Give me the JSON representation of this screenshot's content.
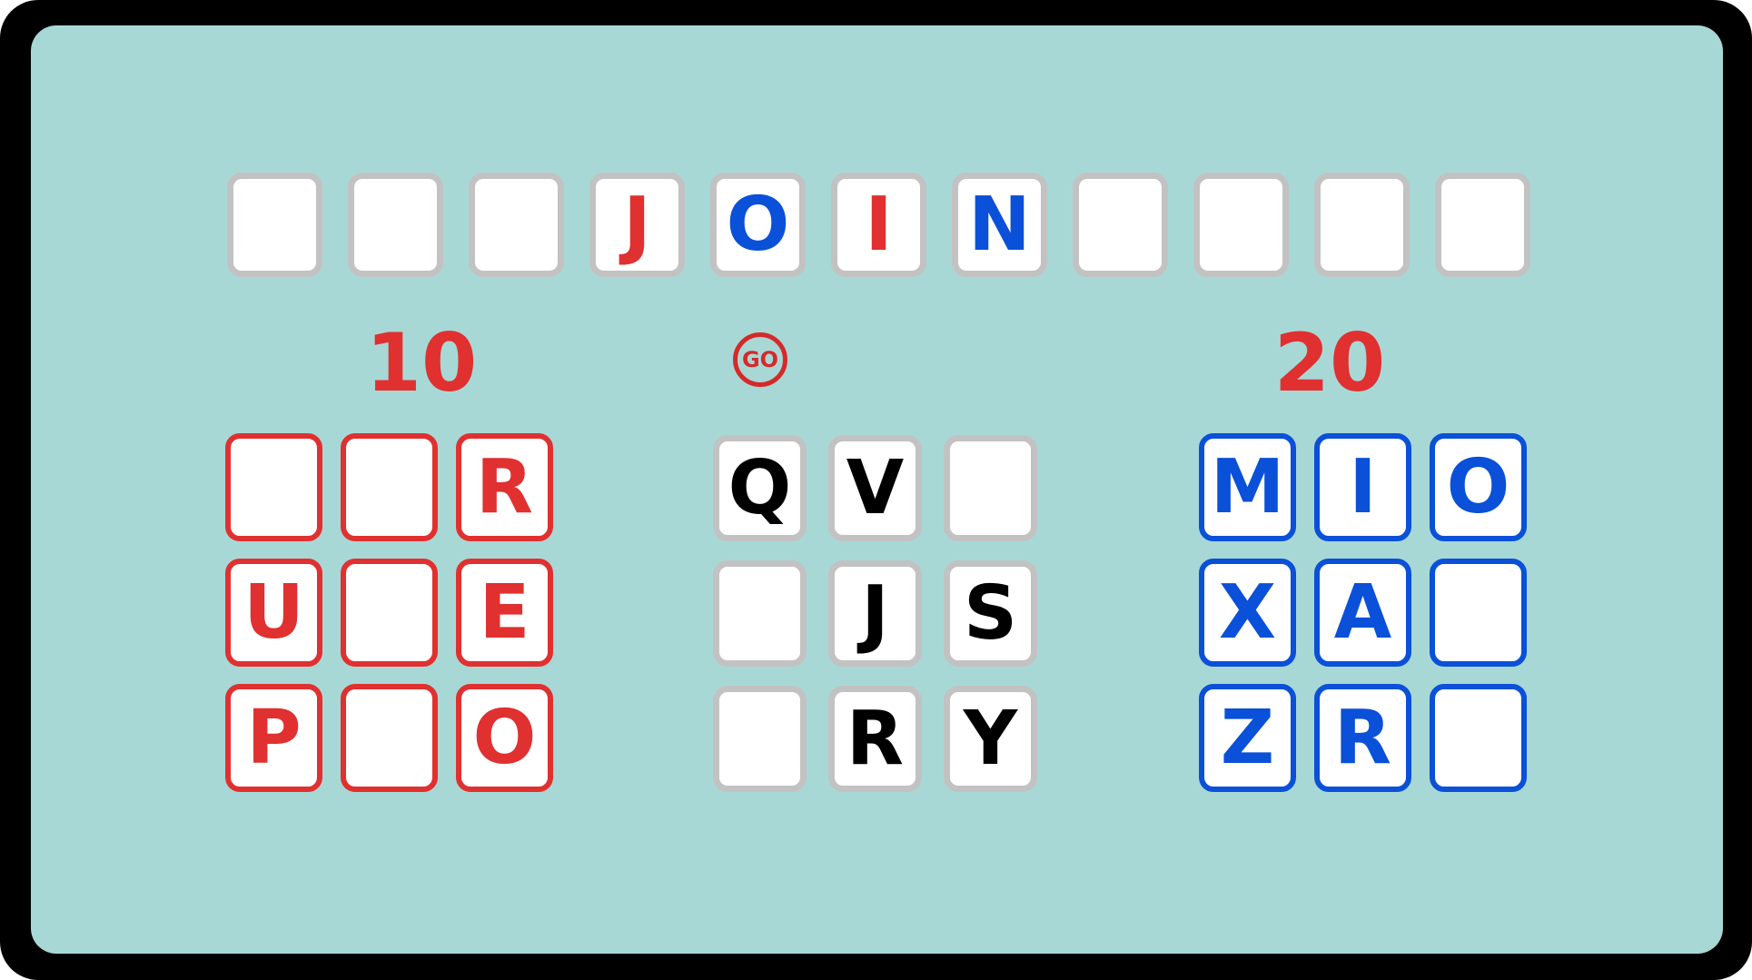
{
  "colors": {
    "board_background": "#a8d8d6",
    "frame": "#000000",
    "red": "#e03030",
    "blue": "#0a50d8",
    "neutral_border": "#c2c2c2"
  },
  "word_row": [
    {
      "letter": "",
      "color": "empty"
    },
    {
      "letter": "",
      "color": "empty"
    },
    {
      "letter": "",
      "color": "empty"
    },
    {
      "letter": "J",
      "color": "red"
    },
    {
      "letter": "O",
      "color": "blue"
    },
    {
      "letter": "I",
      "color": "red"
    },
    {
      "letter": "N",
      "color": "blue"
    },
    {
      "letter": "",
      "color": "empty"
    },
    {
      "letter": "",
      "color": "empty"
    },
    {
      "letter": "",
      "color": "empty"
    },
    {
      "letter": "",
      "color": "empty"
    }
  ],
  "red_player": {
    "score": "10",
    "grid": [
      [
        "",
        "",
        "R"
      ],
      [
        "U",
        "",
        "E"
      ],
      [
        "P",
        "",
        "O"
      ]
    ]
  },
  "go_button": {
    "label": "GO"
  },
  "pool": {
    "grid": [
      [
        "Q",
        "V",
        ""
      ],
      [
        "",
        "J",
        "S"
      ],
      [
        "",
        "R",
        "Y"
      ]
    ]
  },
  "blue_player": {
    "score": "20",
    "grid": [
      [
        "M",
        "I",
        "O"
      ],
      [
        "X",
        "A",
        ""
      ],
      [
        "Z",
        "R",
        ""
      ]
    ]
  }
}
